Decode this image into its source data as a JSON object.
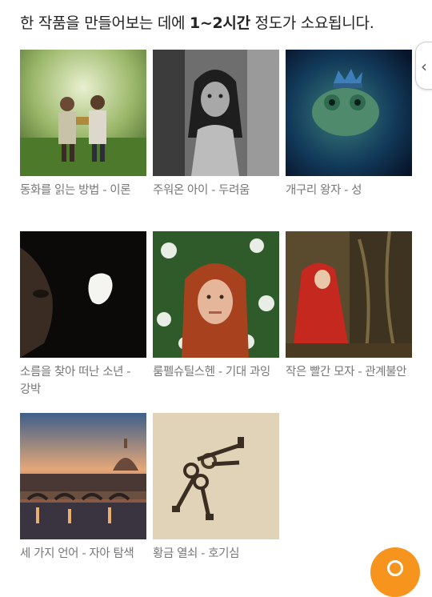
{
  "header": {
    "text_before": "한 작품을 만들어보는 데에 ",
    "duration": "1~2시간",
    "text_after": " 정도가 소요됩니다."
  },
  "books": [
    {
      "caption": "동화를 읽는 방법 - 이론"
    },
    {
      "caption": "주워온 아이 - 두려움"
    },
    {
      "caption": "개구리 왕자 - 성"
    },
    {
      "caption": "소름을 찾아 떠난 소년 - 강박"
    },
    {
      "caption": "룸펠슈틸스헨 - 기대 과잉"
    },
    {
      "caption": "작은 빨간 모자 - 관계불안"
    },
    {
      "caption": "세 가지 언어 - 자아 탐색"
    },
    {
      "caption": "황금 열쇠 - 호기심"
    }
  ],
  "side_tab": {
    "icon": "chevron-left-icon",
    "glyph": "‹"
  },
  "fab": {
    "icon": "help-icon",
    "color": "#f7941d"
  }
}
